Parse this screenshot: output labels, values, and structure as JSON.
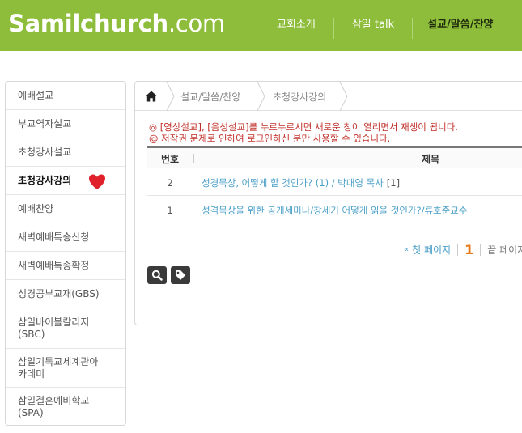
{
  "header": {
    "logo_bold": "Samilchurch",
    "logo_light": ".com",
    "nav": [
      "교회소개",
      "삼일 talk",
      "설교/말씀/찬양"
    ]
  },
  "sidebar": {
    "items": [
      {
        "label": "예배설교"
      },
      {
        "label": "부교역자설교"
      },
      {
        "label": "초청강사설교"
      },
      {
        "label": "초청강사강의",
        "active": true
      },
      {
        "label": "예배찬양"
      },
      {
        "label": "새벽예배특송신청"
      },
      {
        "label": "새벽예배특송확정"
      },
      {
        "label": "성경공부교재(GBS)"
      },
      {
        "label": "삼일바이블칼리지\n(SBC)"
      },
      {
        "label": "삼일기독교세계관아\n카데미"
      },
      {
        "label": "삼일결혼예비학교\n(SPA)"
      }
    ]
  },
  "breadcrumb": [
    "설교/말씀/찬양",
    "초청강사강의"
  ],
  "notice": {
    "line1": "◎ [영상설교], [음성설교]를 누르누르시면 새로운 창이 열리면서 재생이 됩니다.",
    "line2": "@ 저작권 문제로 인하여 로그인하신 분만 사용할 수 있습니다."
  },
  "board": {
    "col_no": "번호",
    "col_title": "제목",
    "rows": [
      {
        "no": "2",
        "title": "성경묵상, 어떻게 할 것인가? (1) / 박대영 목사",
        "count": "[1]"
      },
      {
        "no": "1",
        "title": "성격묵상을 위한 공개세미나/창세기 어떻게 읽을 것인가?/류호준교수",
        "count": ""
      }
    ]
  },
  "pager": {
    "first": "첫 페이지",
    "current": "1",
    "last": "끝 페이지"
  },
  "icons": {
    "home": "home-icon",
    "heart": "heart-icon",
    "search": "search-icon",
    "tag": "tag-icon"
  },
  "colors": {
    "header_green": "#8dbd3a",
    "link_blue": "#4a9fc7",
    "notice_red": "#c0302a",
    "current_page_orange": "#e87a1c"
  }
}
